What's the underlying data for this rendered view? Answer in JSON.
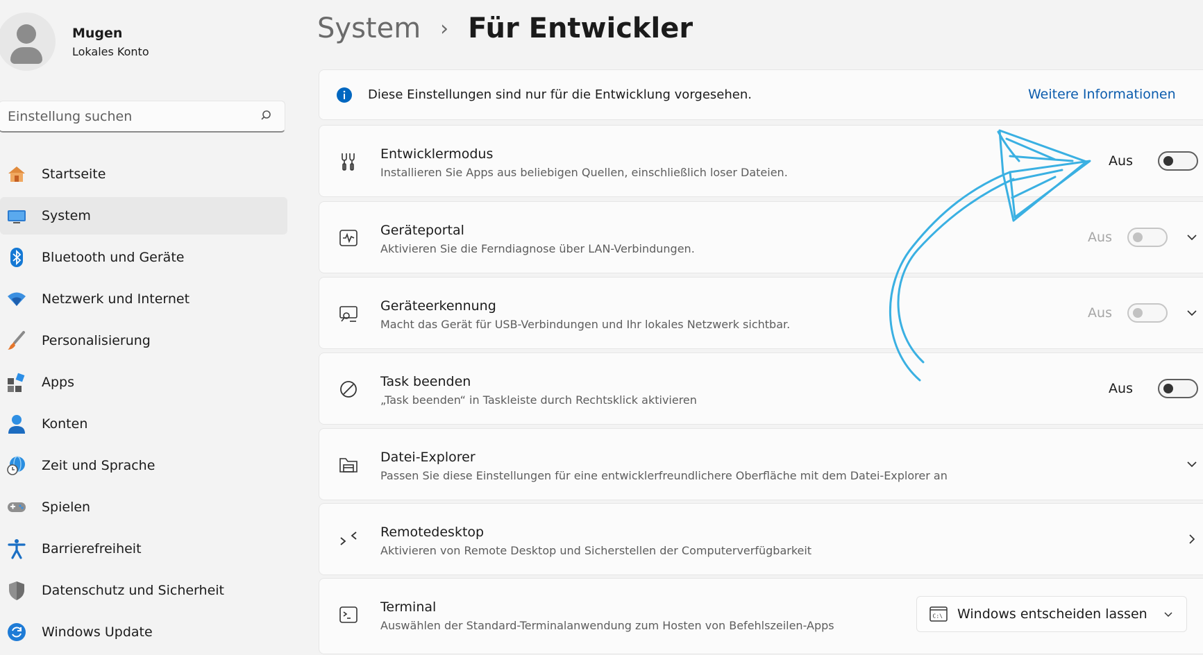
{
  "profile": {
    "name": "Mugen",
    "account_type": "Lokales Konto"
  },
  "search": {
    "placeholder": "Einstellung suchen"
  },
  "nav": [
    {
      "label": "Startseite",
      "icon": "home-icon",
      "active": false
    },
    {
      "label": "System",
      "icon": "system-icon",
      "active": true
    },
    {
      "label": "Bluetooth und Geräte",
      "icon": "bluetooth-icon",
      "active": false
    },
    {
      "label": "Netzwerk und Internet",
      "icon": "wifi-icon",
      "active": false
    },
    {
      "label": "Personalisierung",
      "icon": "brush-icon",
      "active": false
    },
    {
      "label": "Apps",
      "icon": "apps-icon",
      "active": false
    },
    {
      "label": "Konten",
      "icon": "account-icon",
      "active": false
    },
    {
      "label": "Zeit und Sprache",
      "icon": "globe-clock-icon",
      "active": false
    },
    {
      "label": "Spielen",
      "icon": "gamepad-icon",
      "active": false
    },
    {
      "label": "Barrierefreiheit",
      "icon": "accessibility-icon",
      "active": false
    },
    {
      "label": "Datenschutz und Sicherheit",
      "icon": "shield-icon",
      "active": false
    },
    {
      "label": "Windows Update",
      "icon": "update-icon",
      "active": false
    }
  ],
  "breadcrumb": {
    "parent": "System",
    "separator": "›",
    "current": "Für Entwickler"
  },
  "info_bar": {
    "text": "Diese Einstellungen sind nur für die Entwicklung vorgesehen.",
    "link": "Weitere Informationen"
  },
  "settings": [
    {
      "title": "Entwicklermodus",
      "description": "Installieren Sie Apps aus beliebigen Quellen, einschließlich loser Dateien.",
      "state": "Aus",
      "icon": "developer-tools-icon"
    },
    {
      "title": "Geräteportal",
      "description": "Aktivieren Sie die Ferndiagnose über LAN-Verbindungen.",
      "state": "Aus",
      "icon": "device-portal-icon"
    },
    {
      "title": "Geräteerkennung",
      "description": "Macht das Gerät für USB-Verbindungen und Ihr lokales Netzwerk sichtbar.",
      "state": "Aus",
      "icon": "device-discovery-icon"
    },
    {
      "title": "Task beenden",
      "description": "„Task beenden“ in Taskleiste durch Rechtsklick aktivieren",
      "state": "Aus",
      "icon": "end-task-icon"
    },
    {
      "title": "Datei-Explorer",
      "description": "Passen Sie diese Einstellungen für eine entwicklerfreundlichere Oberfläche mit dem Datei-Explorer an",
      "icon": "file-explorer-icon"
    },
    {
      "title": "Remotedesktop",
      "description": "Aktivieren von Remote Desktop und Sicherstellen der Computerverfügbarkeit",
      "icon": "remote-desktop-icon"
    },
    {
      "title": "Terminal",
      "description": "Auswählen der Standard-Terminalanwendung zum Hosten von Befehlszeilen-Apps",
      "icon": "terminal-icon",
      "selected_value": "Windows entscheiden lassen"
    }
  ],
  "colors": {
    "accent": "#0b5cad",
    "annotation_arrow": "#3ab0e2",
    "info": "#0067c0"
  }
}
